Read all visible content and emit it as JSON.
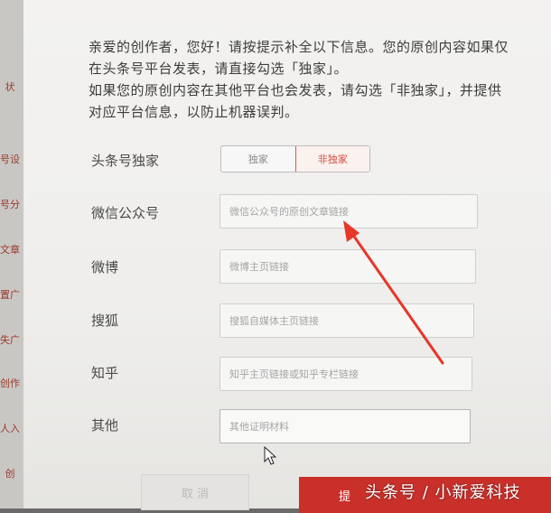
{
  "sidebar": {
    "tabs": [
      "状",
      "号设",
      "号分",
      "文章",
      "置广",
      "失广",
      "创作",
      "人入",
      "创"
    ]
  },
  "intro": {
    "line1": "亲爱的创作者，您好！请按提示补全以下信息。您的原创内容如果仅在头条号平台发表，请直接勾选「独家」。",
    "line2": "如果您的原创内容在其他平台也会发表，请勾选「非独家」，并提供对应平台信息，以防止机器误判。"
  },
  "exclusive": {
    "label": "头条号独家",
    "options": [
      "独家",
      "非独家"
    ],
    "selected": "非独家"
  },
  "fields": {
    "wechat": {
      "label": "微信公众号",
      "placeholder": "微信公众号的原创文章链接"
    },
    "weibo": {
      "label": "微博",
      "placeholder": "微博主页链接"
    },
    "sohu": {
      "label": "搜狐",
      "placeholder": "搜狐自媒体主页链接"
    },
    "zhihu": {
      "label": "知乎",
      "placeholder": "知乎主页链接或知乎专栏链接"
    },
    "other": {
      "label": "其他",
      "placeholder": "其他证明材料"
    }
  },
  "buttons": {
    "cancel": "取 消",
    "submit": "提"
  },
  "watermark": "头条号 / 小新爱科技",
  "colors": {
    "accent": "#d05040",
    "submit_bg": "#c9302a",
    "arrow": "#e8362a"
  }
}
